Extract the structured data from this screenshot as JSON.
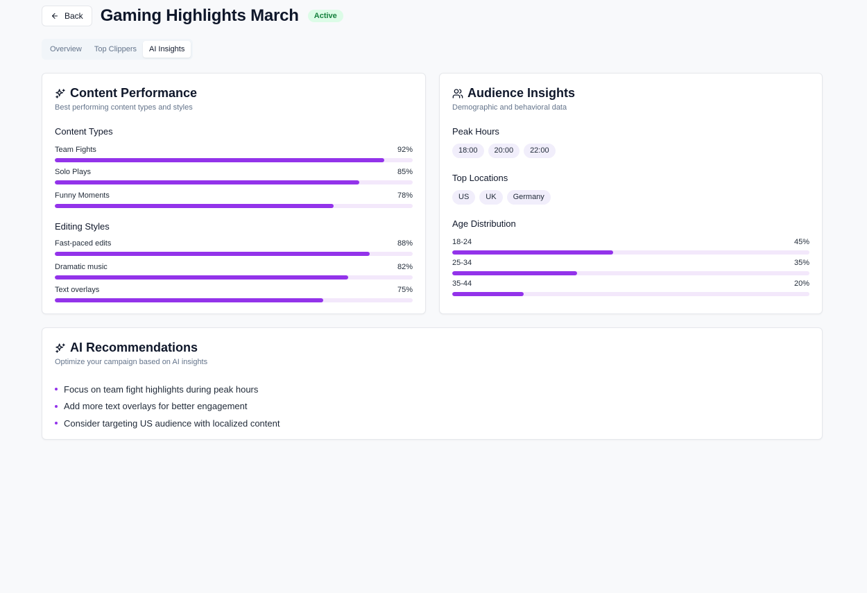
{
  "header": {
    "back_label": "Back",
    "title": "Gaming Highlights March",
    "status": "Active"
  },
  "tabs": [
    {
      "label": "Overview",
      "active": false
    },
    {
      "label": "Top Clippers",
      "active": false
    },
    {
      "label": "AI Insights",
      "active": true
    }
  ],
  "content_performance": {
    "title": "Content Performance",
    "subtitle": "Best performing content types and styles",
    "content_types": {
      "label": "Content Types",
      "items": [
        {
          "label": "Team Fights",
          "value": "92%",
          "percent": 92
        },
        {
          "label": "Solo Plays",
          "value": "85%",
          "percent": 85
        },
        {
          "label": "Funny Moments",
          "value": "78%",
          "percent": 78
        }
      ]
    },
    "editing_styles": {
      "label": "Editing Styles",
      "items": [
        {
          "label": "Fast-paced edits",
          "value": "88%",
          "percent": 88
        },
        {
          "label": "Dramatic music",
          "value": "82%",
          "percent": 82
        },
        {
          "label": "Text overlays",
          "value": "75%",
          "percent": 75
        }
      ]
    }
  },
  "audience_insights": {
    "title": "Audience Insights",
    "subtitle": "Demographic and behavioral data",
    "peak_hours": {
      "label": "Peak Hours",
      "items": [
        "18:00",
        "20:00",
        "22:00"
      ]
    },
    "top_locations": {
      "label": "Top Locations",
      "items": [
        "US",
        "UK",
        "Germany"
      ]
    },
    "age_distribution": {
      "label": "Age Distribution",
      "items": [
        {
          "label": "18-24",
          "value": "45%",
          "percent": 45
        },
        {
          "label": "25-34",
          "value": "35%",
          "percent": 35
        },
        {
          "label": "35-44",
          "value": "20%",
          "percent": 20
        }
      ]
    }
  },
  "ai_recommendations": {
    "title": "AI Recommendations",
    "subtitle": "Optimize your campaign based on AI insights",
    "items": [
      "Focus on team fight highlights during peak hours",
      "Add more text overlays for better engagement",
      "Consider targeting US audience with localized content"
    ]
  },
  "colors": {
    "accent": "#9333ea",
    "bar_track": "#f3e8fb",
    "status_bg": "#dcfce7",
    "status_text": "#15803d"
  }
}
